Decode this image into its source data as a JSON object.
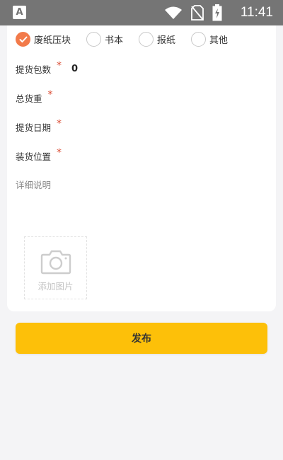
{
  "status_bar": {
    "app_icon_letter": "A",
    "time": "11:41",
    "icons": [
      "wifi-icon",
      "no-sim-icon",
      "battery-charging-icon"
    ]
  },
  "categories": [
    {
      "label": "废纸压块",
      "checked": true
    },
    {
      "label": "书本",
      "checked": false
    },
    {
      "label": "报纸",
      "checked": false
    },
    {
      "label": "其他",
      "checked": false
    }
  ],
  "form": {
    "package_count": {
      "label": "提货包数",
      "required_mark": "*",
      "value": "0"
    },
    "total_weight": {
      "label": "总货重",
      "required_mark": "*",
      "value": ""
    },
    "pickup_date": {
      "label": "提货日期",
      "required_mark": "*",
      "value": ""
    },
    "loading_location": {
      "label": "装货位置",
      "required_mark": "*",
      "value": ""
    },
    "description": {
      "label": "详细说明",
      "value": ""
    }
  },
  "upload": {
    "label": "添加图片",
    "icon": "camera-icon"
  },
  "publish_button": {
    "label": "发布"
  },
  "colors": {
    "accent": "#f27a4a",
    "required": "#d9482f",
    "button": "#fdc009",
    "status_bar": "#757575",
    "background": "#f4f4f6"
  }
}
